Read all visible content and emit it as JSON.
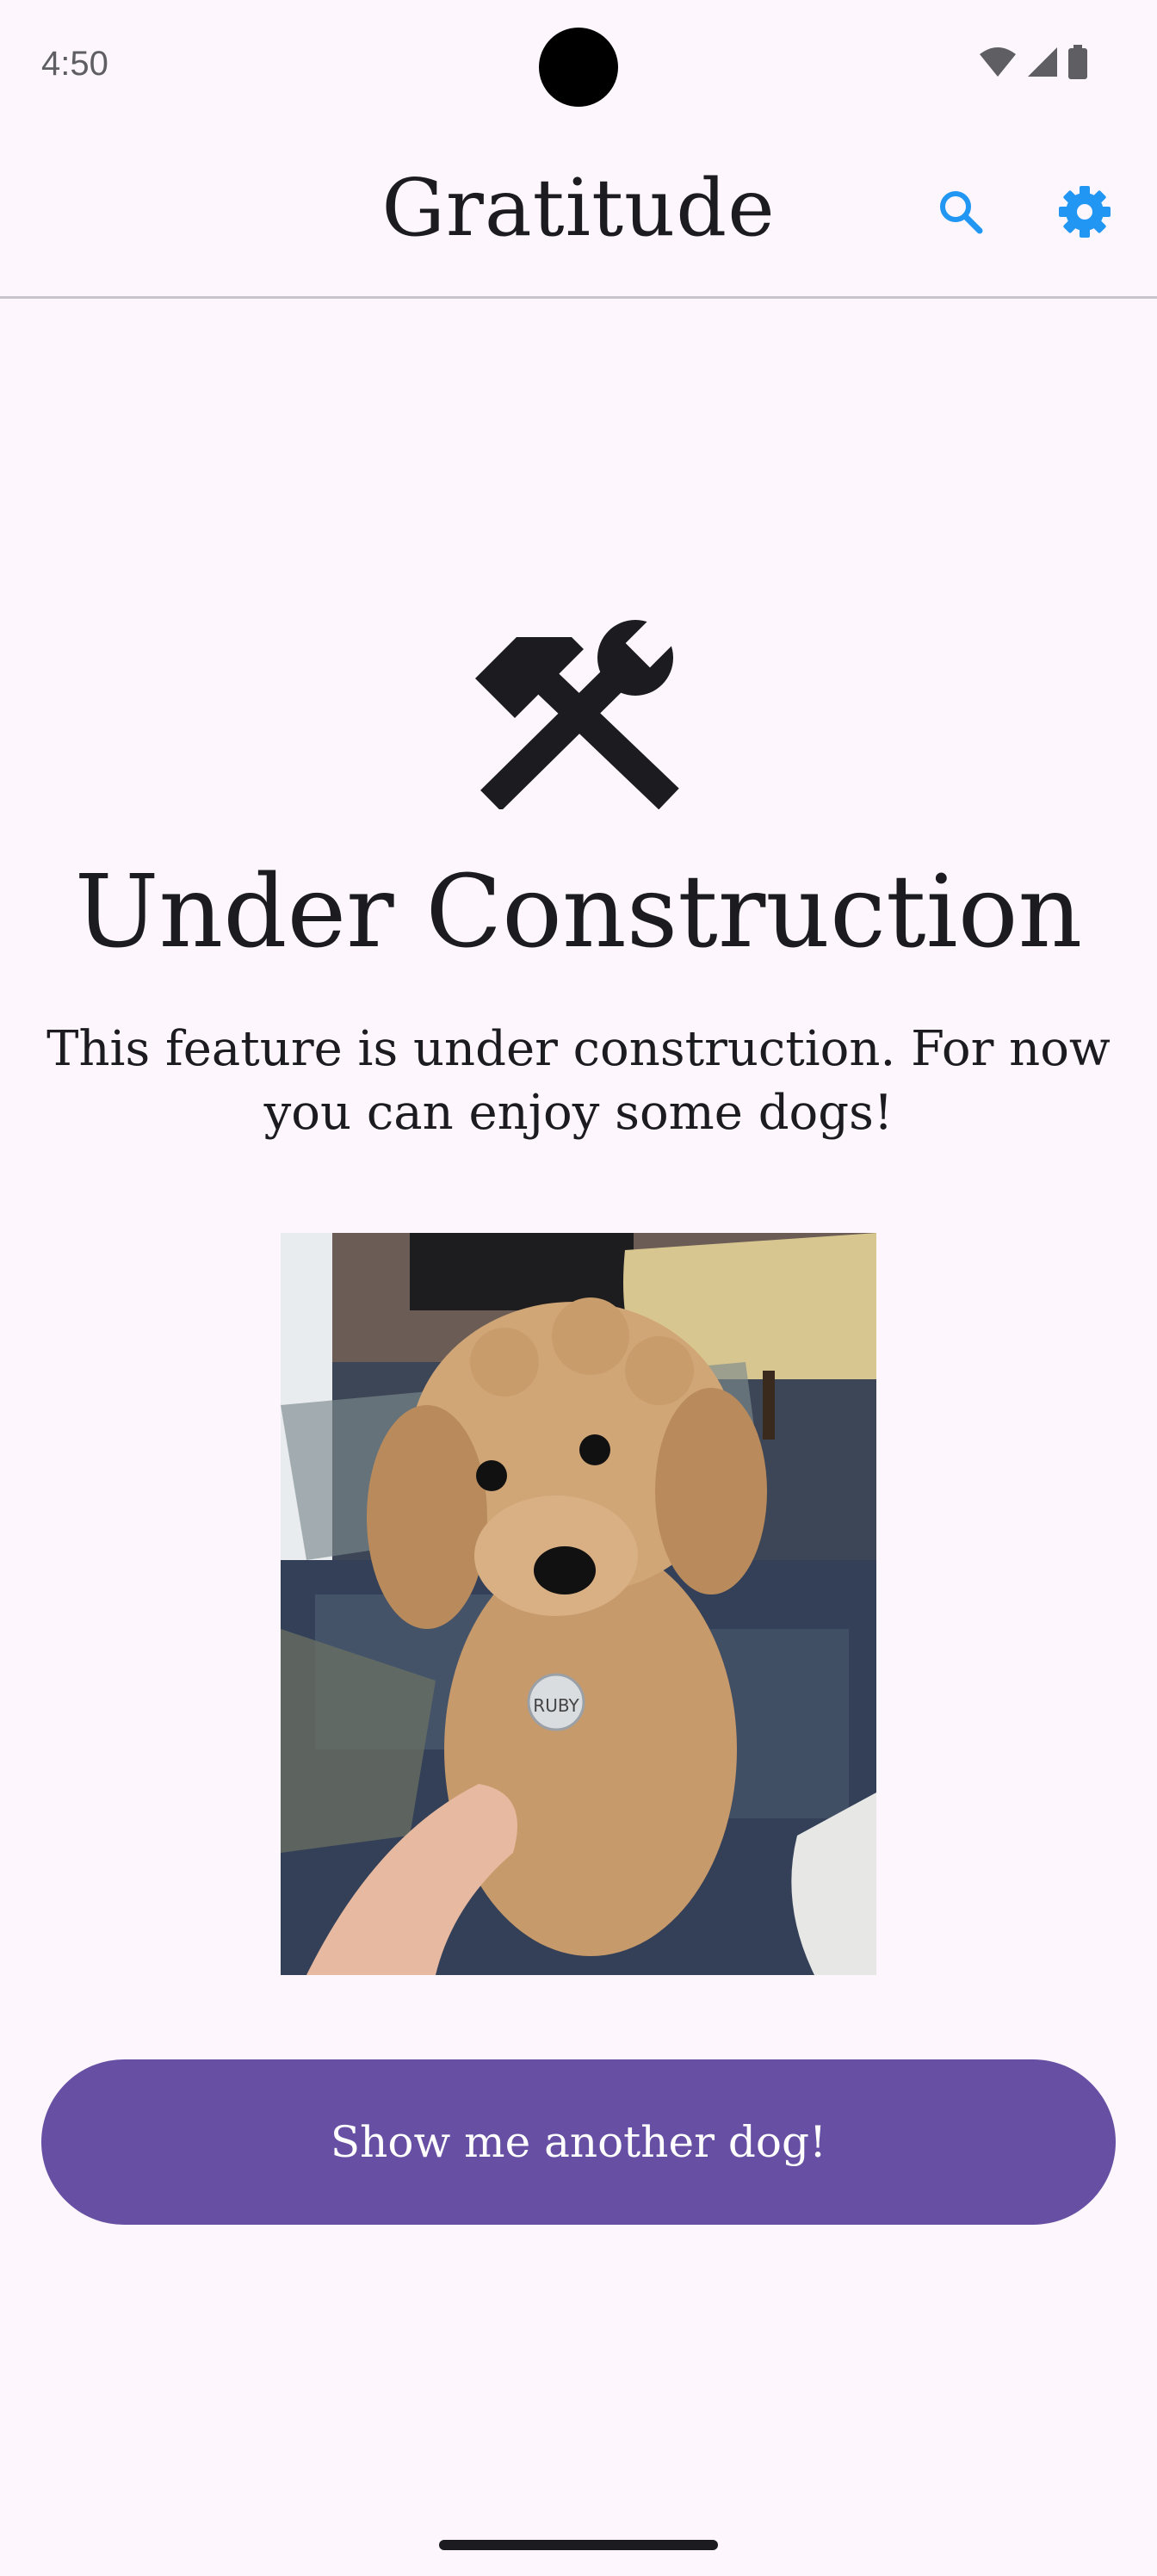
{
  "status_bar": {
    "time": "4:50",
    "icons": [
      "wifi-icon",
      "cell-signal-icon",
      "battery-icon"
    ]
  },
  "app_bar": {
    "title": "Gratitude",
    "actions": [
      {
        "name": "search",
        "icon": "search-icon"
      },
      {
        "name": "settings",
        "icon": "gear-icon"
      }
    ]
  },
  "main": {
    "icon": "hammer-wrench-icon",
    "heading": "Under Construction",
    "message": "This feature is under construction. For now you can enjoy some dogs!",
    "image": {
      "subject": "dog-photo",
      "tag_text": "RUBY"
    },
    "button_label": "Show me another dog!"
  },
  "colors": {
    "background": "#fdf7fd",
    "accent": "#2196f3",
    "primary": "#6750a4",
    "on_primary": "#ffffff",
    "text": "#1c1b1f"
  }
}
